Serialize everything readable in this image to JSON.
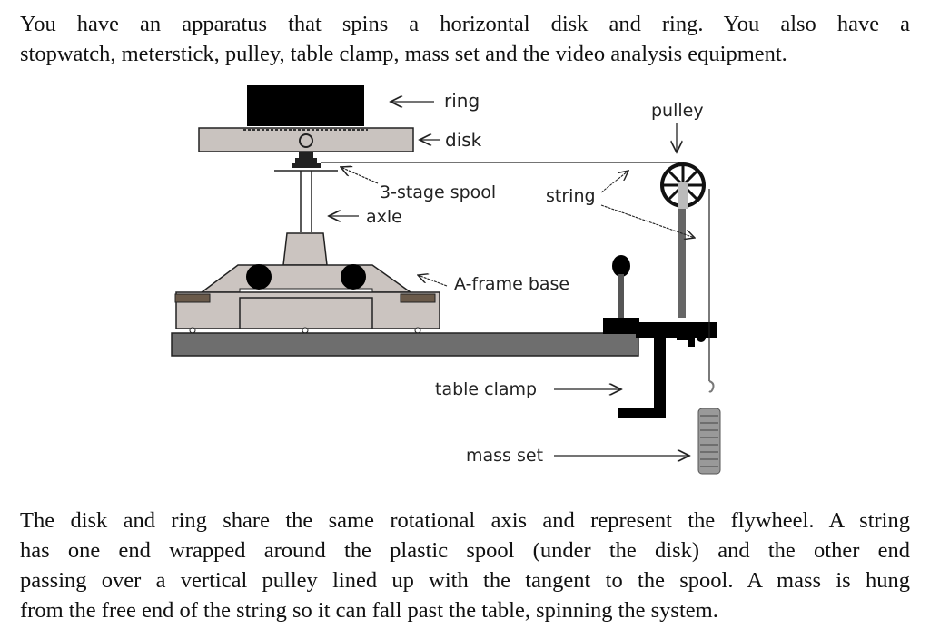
{
  "intro_paragraph": {
    "lines": [
      "You have an apparatus that spins a horizontal disk and ring.  You also have a",
      "stopwatch, meterstick, pulley, table clamp, mass set and the video analysis equipment."
    ]
  },
  "diagram": {
    "labels": {
      "ring": "ring",
      "disk": "disk",
      "spool": "3-stage spool",
      "axle": "axle",
      "string": "string",
      "pulley": "pulley",
      "aframe": "A-frame base",
      "table_clamp": "table clamp",
      "mass_set": "mass set"
    },
    "colors": {
      "ring": "#000000",
      "disk": "#c9c3bf",
      "base": "#cbc4c0",
      "table": "#6e6e6e",
      "clamp": "#000000"
    }
  },
  "closing_paragraph": {
    "lines": [
      "The disk and ring share the same rotational axis and represent the flywheel.  A string",
      "has one end wrapped around the plastic spool (under the disk) and the other end",
      "passing over a vertical pulley lined up with the tangent to the spool.  A mass is hung",
      "from the free end of the string so it can fall past the table, spinning the system."
    ]
  }
}
